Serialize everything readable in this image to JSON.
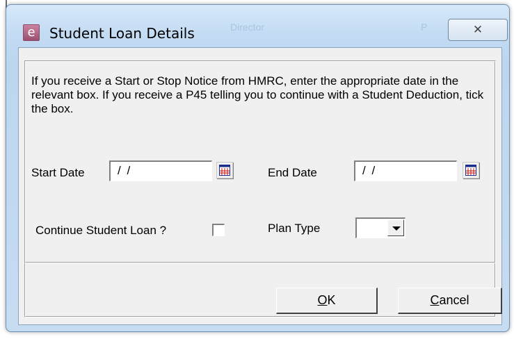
{
  "dialog": {
    "title": "Student Loan Details",
    "title_icon": "app-e-icon",
    "close_label": "✕",
    "background_hint_1": "Director",
    "background_hint_2": "P"
  },
  "instructions": "If you receive a Start or Stop Notice from HMRC, enter the appropriate date in the relevant box. If you receive a P45 telling you to continue with a Student Deduction, tick the box.",
  "start_date": {
    "label": "Start Date",
    "value": "/ /"
  },
  "end_date": {
    "label": "End Date",
    "value": "/ /"
  },
  "calendar_icon": "calendar-icon",
  "continue_loan": {
    "label": "Continue Student Loan ?",
    "checked": false
  },
  "plan_type": {
    "label": "Plan Type",
    "value": ""
  },
  "buttons": {
    "ok_mnemonic": "O",
    "ok_rest": "K",
    "cancel_mnemonic": "C",
    "cancel_rest": "ancel"
  },
  "colors": {
    "title_bar": "#c4dcf3",
    "client": "#f0f0f0",
    "icon": "#9c4f70"
  }
}
